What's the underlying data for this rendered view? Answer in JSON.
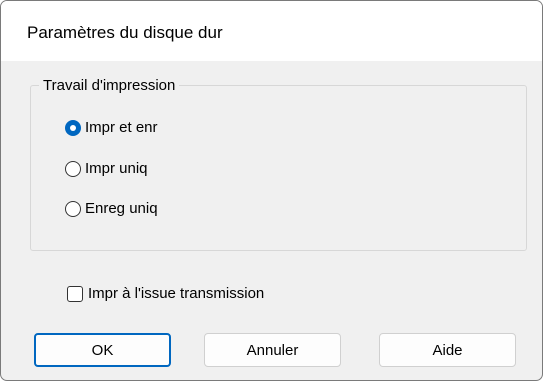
{
  "dialog": {
    "title": "Paramètres du disque dur"
  },
  "print_job": {
    "legend": "Travail d'impression",
    "options": [
      {
        "label": "Impr et enr",
        "selected": true
      },
      {
        "label": "Impr uniq",
        "selected": false
      },
      {
        "label": "Enreg uniq",
        "selected": false
      }
    ]
  },
  "print_after_transmission": {
    "label": "Impr à l'issue transmission",
    "checked": false
  },
  "buttons": {
    "ok": "OK",
    "cancel": "Annuler",
    "help": "Aide"
  },
  "colors": {
    "accent": "#0067c0",
    "dialog_bg": "#f0f0f0",
    "titlebar_bg": "#ffffff"
  }
}
